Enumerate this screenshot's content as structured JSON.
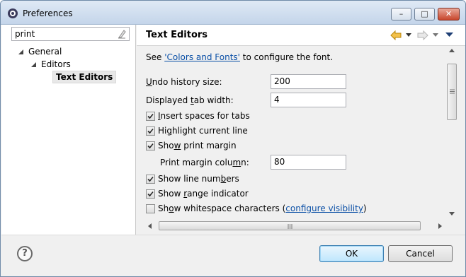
{
  "window": {
    "title": "Preferences",
    "controls": {
      "minimize": "–",
      "maximize": "□",
      "close": "✕"
    }
  },
  "filter": {
    "value": "print",
    "clear_icon": "eraser-icon"
  },
  "tree": {
    "items": [
      {
        "label": "General",
        "level": 0,
        "expanded": true
      },
      {
        "label": "Editors",
        "level": 1,
        "expanded": true
      },
      {
        "label": "Text Editors",
        "level": 2,
        "selected": true
      }
    ]
  },
  "page": {
    "title": "Text Editors",
    "intro_prefix": "See ",
    "intro_link": "'Colors and Fonts'",
    "intro_suffix": " to configure the font.",
    "undo_history": {
      "label_pre": "",
      "label_mn": "U",
      "label_post": "ndo history size:",
      "value": "200"
    },
    "tab_width": {
      "label_pre": "Displayed ",
      "label_mn": "t",
      "label_post": "ab width:",
      "value": "4"
    },
    "checkboxes": [
      {
        "pre": "",
        "mn": "I",
        "post": "nsert spaces for tabs",
        "checked": true
      },
      {
        "pre": "Hi",
        "mn": "g",
        "post": "hlight current line",
        "checked": true
      },
      {
        "pre": "Sho",
        "mn": "w",
        "post": " print margin",
        "checked": true
      }
    ],
    "print_margin": {
      "label_pre": "Print margin colu",
      "label_mn": "m",
      "label_post": "n:",
      "value": "80"
    },
    "checkboxes2": [
      {
        "pre": "Show line num",
        "mn": "b",
        "post": "ers",
        "checked": true
      },
      {
        "pre": "Show ",
        "mn": "r",
        "post": "ange indicator",
        "checked": true
      },
      {
        "pre": "Sh",
        "mn": "o",
        "post": "w whitespace characters",
        "checked": false,
        "link": "configure visibility"
      }
    ]
  },
  "buttons": {
    "ok": "OK",
    "cancel": "Cancel",
    "help": "?"
  },
  "colors": {
    "accent": "#0a4fa6",
    "title_bar": "#c4d5ea"
  }
}
